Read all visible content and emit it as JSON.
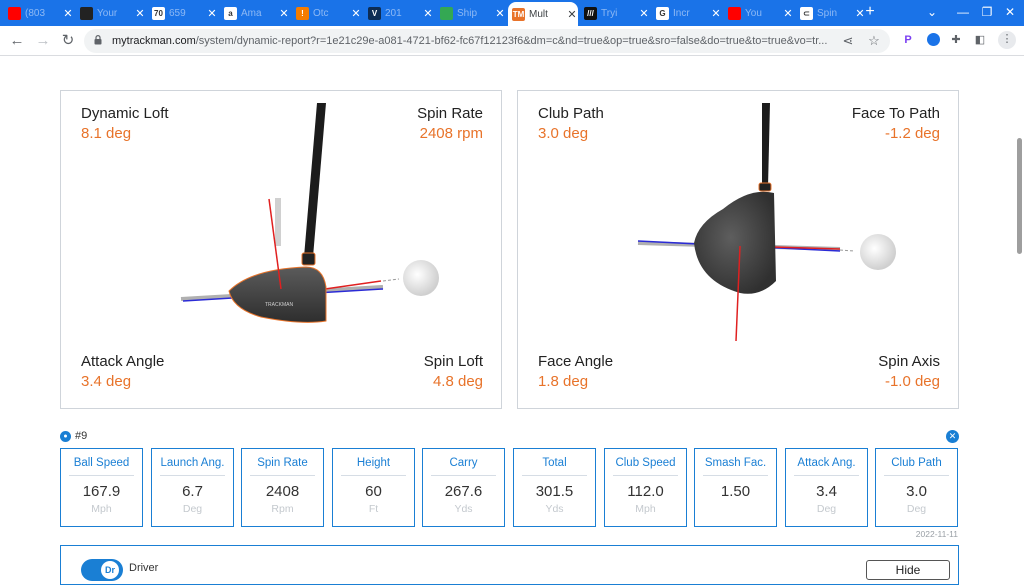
{
  "browser": {
    "tabs": [
      {
        "title": "(803",
        "icon": "youtube-icon",
        "color": "#ff0000"
      },
      {
        "title": "Your",
        "icon": "under-armour-icon",
        "color": "#222222"
      },
      {
        "title": "659",
        "icon": "seventy-icon",
        "color": "#ffffff",
        "glyph": "70"
      },
      {
        "title": "Ama",
        "icon": "amazon-icon",
        "color": "#ffffff",
        "glyph": "a"
      },
      {
        "title": "Otc",
        "icon": "alert-icon",
        "color": "#f57c00",
        "glyph": "!"
      },
      {
        "title": "201",
        "icon": "v-icon",
        "color": "#0d2c54",
        "glyph": "V"
      },
      {
        "title": "Ship",
        "icon": "shipping-icon",
        "color": "#34a853"
      },
      {
        "title": "Mult",
        "icon": "trackman-icon",
        "color": "#e8732a",
        "glyph": "TM",
        "active": true
      },
      {
        "title": "Tryi",
        "icon": "stripes-icon",
        "color": "#111111",
        "glyph": "///"
      },
      {
        "title": "Incr",
        "icon": "google-icon",
        "color": "#ffffff",
        "glyph": "G"
      },
      {
        "title": "You",
        "icon": "youtube-icon",
        "color": "#ff0000"
      },
      {
        "title": "Spin",
        "icon": "spin-icon",
        "color": "#ffffff",
        "glyph": "⊂"
      }
    ],
    "url_host": "mytrackman.com",
    "url_rest": "/system/dynamic-report?r=1e21c29e-a081-4721-bf62-fc67f12123f6&dm=c&nd=true&op=true&sro=false&do=true&to=true&vo=tr..."
  },
  "panels": {
    "left": {
      "top_left_label": "Dynamic Loft",
      "top_left_value": "8.1 deg",
      "top_right_label": "Spin Rate",
      "top_right_value": "2408 rpm",
      "bottom_left_label": "Attack Angle",
      "bottom_left_value": "3.4 deg",
      "bottom_right_label": "Spin Loft",
      "bottom_right_value": "4.8 deg",
      "club_brand": "TRACKMAN"
    },
    "right": {
      "top_left_label": "Club Path",
      "top_left_value": "3.0 deg",
      "top_right_label": "Face To Path",
      "top_right_value": "-1.2 deg",
      "bottom_left_label": "Face Angle",
      "bottom_left_value": "1.8 deg",
      "bottom_right_label": "Spin Axis",
      "bottom_right_value": "-1.0 deg"
    }
  },
  "shot": {
    "label": "#9",
    "date": "2022-11-11",
    "metrics": [
      {
        "label": "Ball Speed",
        "value": "167.9",
        "unit": "Mph"
      },
      {
        "label": "Launch Ang.",
        "value": "6.7",
        "unit": "Deg"
      },
      {
        "label": "Spin Rate",
        "value": "2408",
        "unit": "Rpm"
      },
      {
        "label": "Height",
        "value": "60",
        "unit": "Ft"
      },
      {
        "label": "Carry",
        "value": "267.6",
        "unit": "Yds"
      },
      {
        "label": "Total",
        "value": "301.5",
        "unit": "Yds"
      },
      {
        "label": "Club Speed",
        "value": "112.0",
        "unit": "Mph"
      },
      {
        "label": "Smash Fac.",
        "value": "1.50",
        "unit": ""
      },
      {
        "label": "Attack Ang.",
        "value": "3.4",
        "unit": "Deg"
      },
      {
        "label": "Club Path",
        "value": "3.0",
        "unit": "Deg"
      }
    ]
  },
  "club": {
    "toggle_label": "Dr",
    "name": "Driver",
    "hide_label": "Hide"
  },
  "colors": {
    "accent": "#1a7fd4",
    "value_orange": "#e8732a",
    "chrome_blue": "#1a73e8"
  }
}
